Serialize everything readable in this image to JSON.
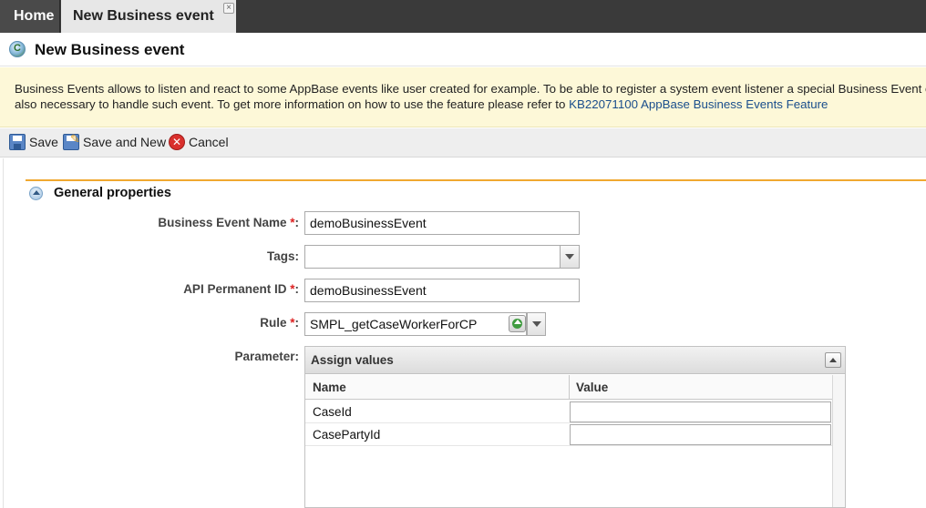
{
  "tabs": {
    "home_label": "Home",
    "active_label": "New Business event"
  },
  "header": {
    "title": "New Business event"
  },
  "banner": {
    "line1": "Business Events allows to listen and react to some AppBase events like user created for example. To be able to register a system event listener a special Business Event cod",
    "line2_prefix": "also necessary to handle such event. To get more information on how to use the feature please refer to ",
    "link_text": "KB22071100 AppBase Business Events Feature"
  },
  "toolbar": {
    "save_label": "Save",
    "save_new_label": "Save and New",
    "cancel_label": "Cancel"
  },
  "section": {
    "title": "General properties"
  },
  "form": {
    "required_marker": "*",
    "name_label": "Business Event Name",
    "name_value": "demoBusinessEvent",
    "tags_label": "Tags:",
    "tags_value": "",
    "api_label": "API Permanent ID",
    "api_value": "demoBusinessEvent",
    "rule_label": "Rule",
    "rule_value": "SMPL_getCaseWorkerForCP",
    "parameter_label": "Parameter:",
    "colon": ":"
  },
  "assign": {
    "title": "Assign values",
    "col_name": "Name",
    "col_value": "Value",
    "rows": [
      {
        "name": "CaseId",
        "value": ""
      },
      {
        "name": "CasePartyId",
        "value": ""
      }
    ]
  }
}
